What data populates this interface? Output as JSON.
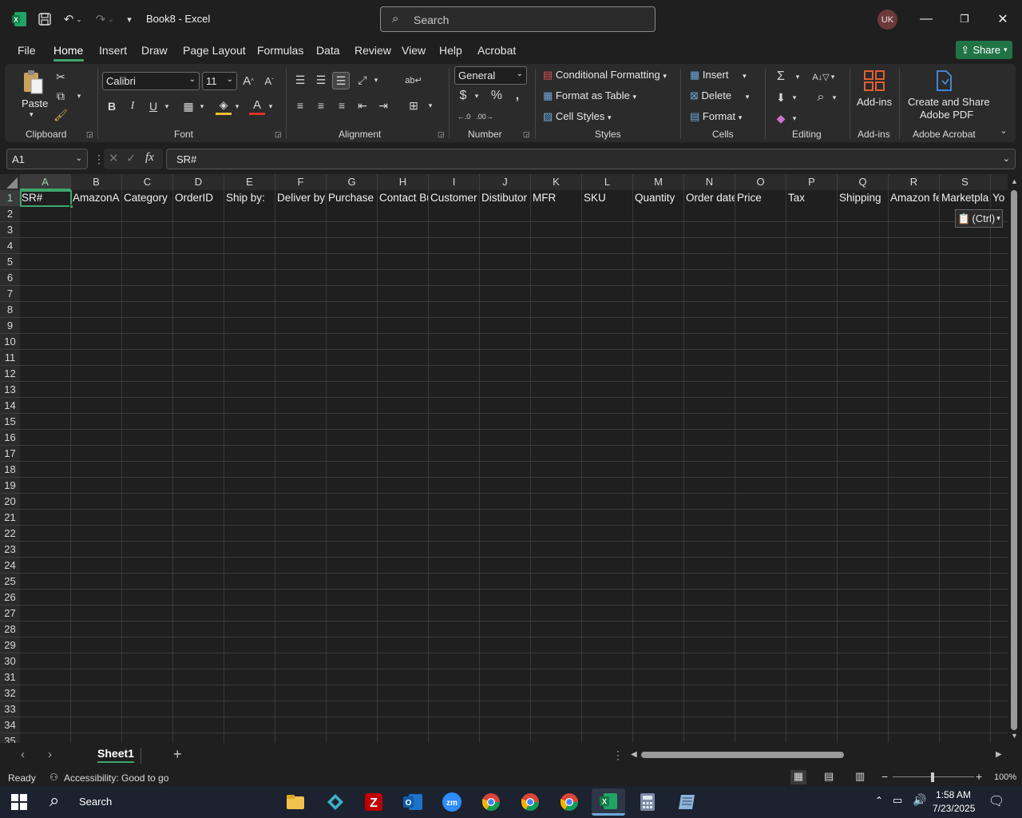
{
  "titlebar": {
    "doc_title": "Book8  -  Excel",
    "search_placeholder": "Search",
    "avatar_initials": "UK"
  },
  "menu": {
    "tabs": [
      "File",
      "Home",
      "Insert",
      "Draw",
      "Page Layout",
      "Formulas",
      "Data",
      "Review",
      "View",
      "Help",
      "Acrobat"
    ],
    "active": "Home",
    "share_label": "Share"
  },
  "ribbon": {
    "clipboard": {
      "paste_label": "Paste",
      "group_label": "Clipboard"
    },
    "font": {
      "font_name": "Calibri",
      "font_size": "11",
      "group_label": "Font"
    },
    "alignment": {
      "group_label": "Alignment"
    },
    "number": {
      "format": "General",
      "group_label": "Number"
    },
    "styles": {
      "conditional": "Conditional Formatting",
      "format_table": "Format as Table",
      "cell_styles": "Cell Styles",
      "group_label": "Styles"
    },
    "cells": {
      "insert": "Insert",
      "delete": "Delete",
      "format": "Format",
      "group_label": "Cells"
    },
    "editing": {
      "group_label": "Editing"
    },
    "addins": {
      "label": "Add-ins",
      "group_label": "Add-ins"
    },
    "acrobat": {
      "label_line1": "Create and Share",
      "label_line2": "Adobe PDF",
      "group_label": "Adobe Acrobat"
    }
  },
  "formula_bar": {
    "name_box": "A1",
    "fx": "fx",
    "value": "SR#"
  },
  "grid": {
    "columns": [
      "A",
      "B",
      "C",
      "D",
      "E",
      "F",
      "G",
      "H",
      "I",
      "J",
      "K",
      "L",
      "M",
      "N",
      "O",
      "P",
      "Q",
      "R",
      "S"
    ],
    "row_count": 35,
    "row1": [
      "SR#",
      "AmazonA",
      "Category",
      "OrderID",
      "Ship by:",
      "Deliver by",
      "Purchase d",
      "Contact Bu",
      "Customer",
      "Distibutor",
      "MFR",
      "SKU",
      "Quantity",
      "Order date",
      "Price",
      "Tax",
      "Shipping",
      "Amazon fe",
      "Marketpla",
      "Yo"
    ],
    "paste_options": "(Ctrl)"
  },
  "sheets": {
    "tabs": [
      "Sheet1"
    ],
    "active": "Sheet1"
  },
  "status": {
    "ready": "Ready",
    "accessibility": "Accessibility: Good to go",
    "zoom": "100%"
  },
  "taskbar": {
    "search_label": "Search",
    "time": "1:58 AM",
    "date": "7/23/2025"
  },
  "colors": {
    "accent": "#3fa66b",
    "share_bg": "#217346",
    "excel_green": "#1d6f42"
  }
}
